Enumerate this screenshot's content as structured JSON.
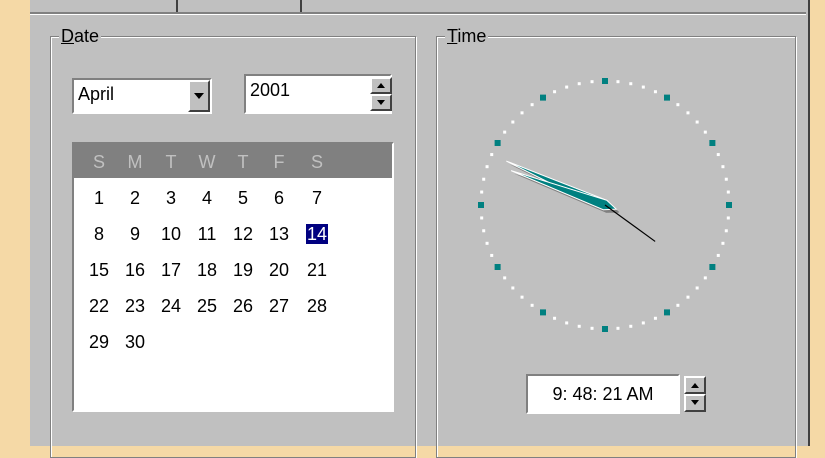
{
  "date_group": {
    "label_key": "D",
    "label_rest": "ate",
    "month_value": "April",
    "year_value": "2001",
    "weekdays": [
      "S",
      "M",
      "T",
      "W",
      "T",
      "F",
      "S"
    ],
    "weeks": [
      [
        "1",
        "2",
        "3",
        "4",
        "5",
        "6",
        "7"
      ],
      [
        "8",
        "9",
        "10",
        "11",
        "12",
        "13",
        "14"
      ],
      [
        "15",
        "16",
        "17",
        "18",
        "19",
        "20",
        "21"
      ],
      [
        "22",
        "23",
        "24",
        "25",
        "26",
        "27",
        "28"
      ],
      [
        "29",
        "30",
        "",
        "",
        "",
        "",
        ""
      ]
    ],
    "selected_day": "14"
  },
  "time_group": {
    "label_key": "T",
    "label_rest": "ime",
    "time_value": "9: 48: 21 AM",
    "clock": {
      "hour": 9,
      "minute": 48,
      "second": 21
    }
  },
  "colors": {
    "face_marker": "#008080",
    "hand": "#008080",
    "selection": "#000080"
  }
}
